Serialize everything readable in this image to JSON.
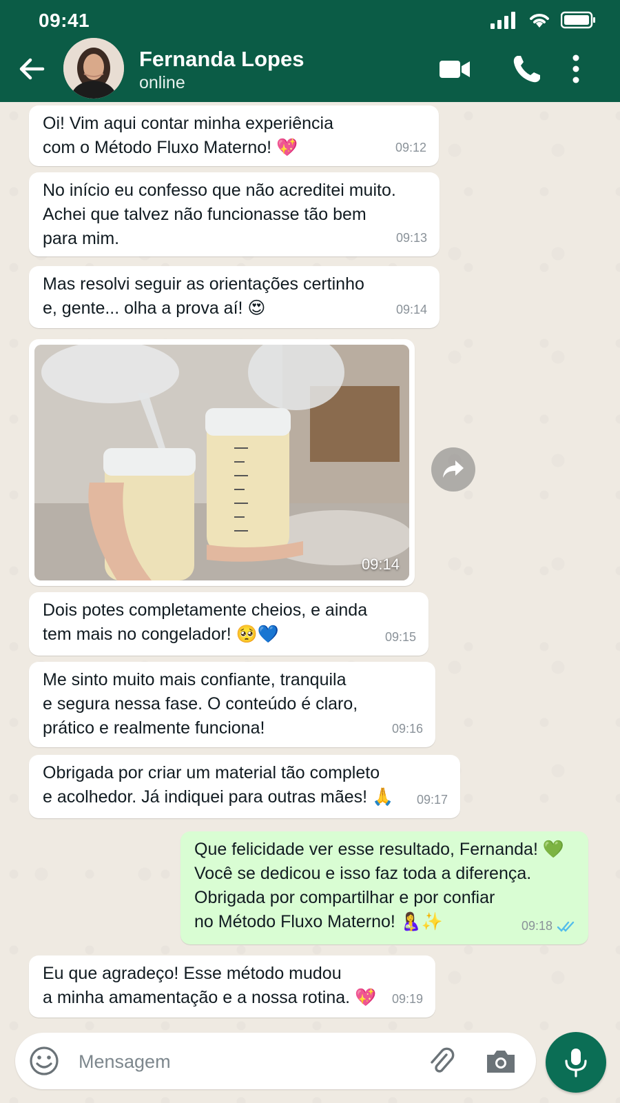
{
  "status_bar": {
    "time": "09:41"
  },
  "header": {
    "contact_name": "Fernanda Lopes",
    "contact_status": "online"
  },
  "messages": [
    {
      "direction": "in",
      "text": "Oi! Vim aqui contar minha experiência\ncom o Método Fluxo Materno! 💖",
      "time": "09:12"
    },
    {
      "direction": "in",
      "text": "No início eu confesso que não acreditei muito.\nAchei que talvez não funcionasse tão bem\npara mim.",
      "time": "09:13"
    },
    {
      "direction": "in",
      "text": "Mas resolvi seguir as orientações certinho\ne, gente... olha a prova aí! 😍",
      "time": "09:14"
    },
    {
      "direction": "in",
      "type": "image",
      "time": "09:14"
    },
    {
      "direction": "in",
      "text": "Dois potes completamente cheios, e ainda\ntem mais no congelador! 🥺💙",
      "time": "09:15"
    },
    {
      "direction": "in",
      "text": "Me sinto muito mais confiante, tranquila\ne segura nessa fase. O conteúdo é claro,\nprático e realmente funciona!",
      "time": "09:16"
    },
    {
      "direction": "in",
      "text": "Obrigada por criar um material tão completo\ne acolhedor. Já indiquei para outras mães! 🙏",
      "time": "09:17"
    },
    {
      "direction": "out",
      "text": "Que felicidade ver esse resultado, Fernanda! 💚\nVocê se dedicou e isso faz toda a diferença.\nObrigada por compartilhar e por confiar\nno Método Fluxo Materno! 🤱✨",
      "time": "09:18"
    },
    {
      "direction": "in",
      "text": "Eu que agradeço! Esse método mudou\na minha amamentação e a nossa rotina. 💖",
      "time": "09:19"
    }
  ],
  "composer": {
    "placeholder": "Mensagem"
  },
  "colors": {
    "header": "#0b5c46",
    "chat_background": "#efeae2",
    "outgoing_bubble": "#d9fdd3",
    "incoming_bubble": "#ffffff",
    "read_ticks": "#53bdeb",
    "mic_button": "#0b6e55"
  }
}
